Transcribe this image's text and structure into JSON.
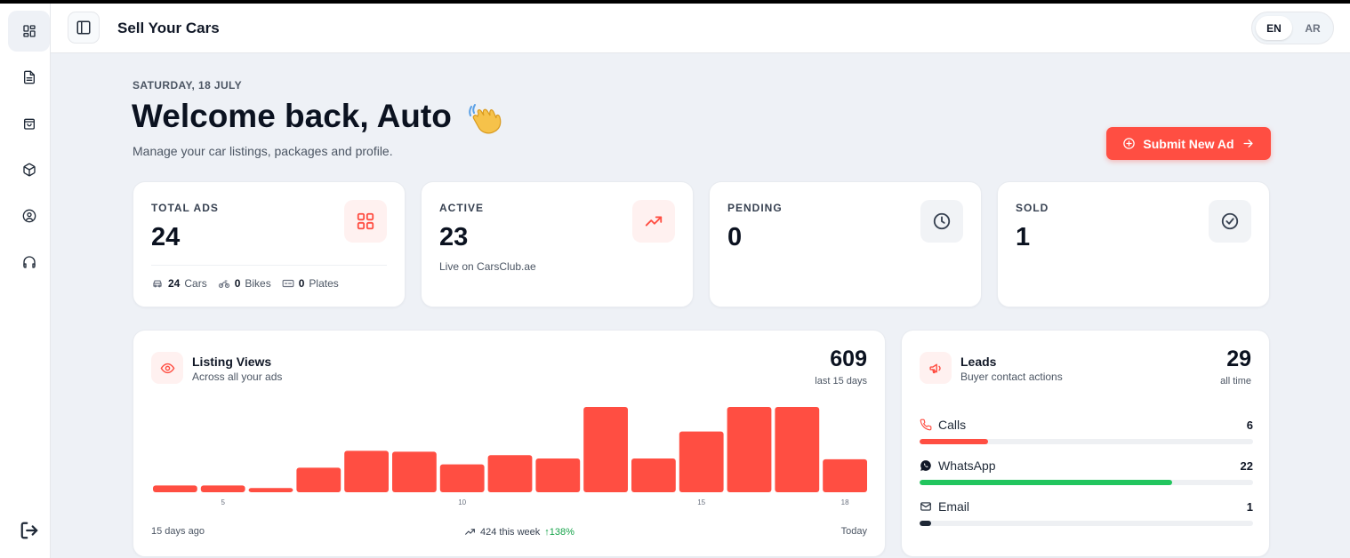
{
  "header": {
    "title": "Sell Your Cars",
    "languages": [
      "EN",
      "AR"
    ],
    "active_language": "EN"
  },
  "sidebar": {
    "items": [
      {
        "icon": "dashboard-icon",
        "active": true
      },
      {
        "icon": "document-icon",
        "active": false
      },
      {
        "icon": "shopping-bag-icon",
        "active": false
      },
      {
        "icon": "package-icon",
        "active": false
      },
      {
        "icon": "user-circle-icon",
        "active": false
      },
      {
        "icon": "headphones-icon",
        "active": false
      }
    ],
    "logout_icon": "logout-icon"
  },
  "welcome": {
    "date": "SATURDAY, 18 JULY",
    "title": "Welcome back, Auto",
    "subtitle": "Manage your car listings, packages and profile.",
    "cta_label": "Submit New Ad"
  },
  "stats": {
    "total": {
      "label": "TOTAL ADS",
      "value": "24",
      "breakdown": [
        {
          "count": "24",
          "label": "Cars",
          "icon": "car-icon"
        },
        {
          "count": "0",
          "label": "Bikes",
          "icon": "bike-icon"
        },
        {
          "count": "0",
          "label": "Plates",
          "icon": "plate-icon"
        }
      ]
    },
    "active": {
      "label": "ACTIVE",
      "value": "23",
      "note": "Live on CarsClub.ae"
    },
    "pending": {
      "label": "PENDING",
      "value": "0"
    },
    "sold": {
      "label": "SOLD",
      "value": "1"
    }
  },
  "views": {
    "title": "Listing Views",
    "subtitle": "Across all your ads",
    "total": "609",
    "total_label": "last 15 days",
    "start_label": "15 days ago",
    "end_label": "Today",
    "week_text": "424 this week",
    "change": "↑138%"
  },
  "chart_data": {
    "type": "bar",
    "categories": [
      "1",
      "2",
      "3",
      "4",
      "5",
      "6",
      "7",
      "8",
      "9",
      "10",
      "11",
      "12",
      "13",
      "14",
      "15"
    ],
    "values": [
      8,
      8,
      5,
      29,
      49,
      48,
      33,
      44,
      40,
      101,
      40,
      72,
      101,
      101,
      39
    ],
    "tick_labels": [
      {
        "index": 1,
        "label": "5"
      },
      {
        "index": 6,
        "label": "10"
      },
      {
        "index": 11,
        "label": "15"
      },
      {
        "index": 14,
        "label": "18"
      }
    ],
    "ylim": [
      0,
      101
    ],
    "color": "#ff4e42",
    "grid": false
  },
  "leads": {
    "title": "Leads",
    "subtitle": "Buyer contact actions",
    "total": "29",
    "total_label": "all time",
    "items": [
      {
        "name": "Calls",
        "value": "6",
        "fraction": 0.206,
        "color": "#ff4e42",
        "icon": "phone-icon"
      },
      {
        "name": "WhatsApp",
        "value": "22",
        "fraction": 0.756,
        "color": "#22c55e",
        "icon": "whatsapp-icon"
      },
      {
        "name": "Email",
        "value": "1",
        "fraction": 0.034,
        "color": "#1f2937",
        "icon": "mail-icon"
      }
    ]
  },
  "colors": {
    "accent": "#ff4e42",
    "success": "#22c55e",
    "background": "#eef1f6"
  }
}
